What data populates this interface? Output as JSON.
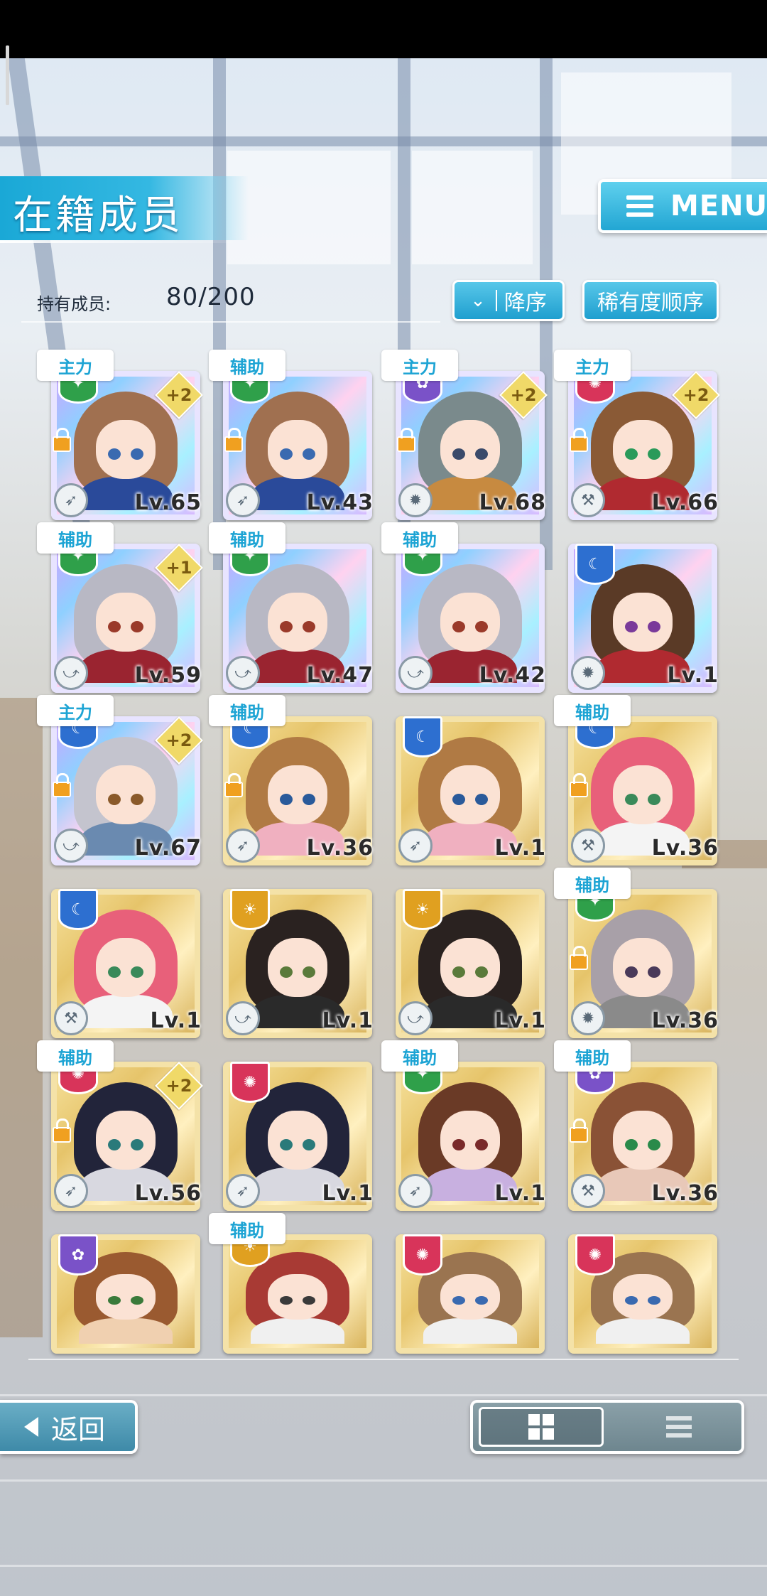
{
  "header": {
    "title": "在籍成员",
    "menu_label": "MENU",
    "menu_icon": "hamburger-icon"
  },
  "summary": {
    "count_label": "持有成员:",
    "count_value": "80/200"
  },
  "sort": {
    "order_label": "降序",
    "order_icon": "double-chevron-down-icon",
    "rarity_label": "稀有度顺序"
  },
  "colors": {
    "accent": "#22a6d3",
    "badge_text": "#1da4d4",
    "plus_gold": "#f0d968",
    "attr_green": "#2fa04a",
    "attr_purple": "#7a52c8",
    "attr_red": "#d8345a",
    "attr_blue": "#2d6fd0",
    "attr_orange": "#e0a020"
  },
  "cards": [
    {
      "role": "主力",
      "plus": "+2",
      "level": "Lv.65",
      "rarity": "sr",
      "attr": "green",
      "locked": true,
      "skill": "wind-icon",
      "hair": "#a07050",
      "eye": "#3a6ab0",
      "outfit": "#2a4a9a"
    },
    {
      "role": "辅助",
      "plus": "",
      "level": "Lv.43",
      "rarity": "sr",
      "attr": "green",
      "locked": true,
      "skill": "wind-icon",
      "hair": "#a07050",
      "eye": "#3a6ab0",
      "outfit": "#2a4a9a"
    },
    {
      "role": "主力",
      "plus": "+2",
      "level": "Lv.68",
      "rarity": "sr",
      "attr": "purple",
      "locked": true,
      "skill": "gear-icon",
      "hair": "#7a8a8c",
      "eye": "#3a4a6a",
      "outfit": "#c78a40"
    },
    {
      "role": "主力",
      "plus": "+2",
      "level": "Lv.66",
      "rarity": "sr",
      "attr": "red",
      "locked": true,
      "skill": "hammer-icon",
      "hair": "#8a5a36",
      "eye": "#2a9a5a",
      "outfit": "#b02a30"
    },
    {
      "role": "辅助",
      "plus": "+1",
      "level": "Lv.59",
      "rarity": "sr",
      "attr": "green",
      "locked": false,
      "skill": "boot-icon",
      "hair": "#b8b8c4",
      "eye": "#9a3a2a",
      "outfit": "#9a2430"
    },
    {
      "role": "辅助",
      "plus": "",
      "level": "Lv.47",
      "rarity": "sr",
      "attr": "green",
      "locked": false,
      "skill": "boot-icon",
      "hair": "#b8b8c4",
      "eye": "#9a3a2a",
      "outfit": "#9a2430"
    },
    {
      "role": "辅助",
      "plus": "",
      "level": "Lv.42",
      "rarity": "sr",
      "attr": "green",
      "locked": false,
      "skill": "boot-icon",
      "hair": "#b8b8c4",
      "eye": "#9a3a2a",
      "outfit": "#9a2430"
    },
    {
      "role": "",
      "plus": "",
      "level": "Lv.1",
      "rarity": "sr",
      "attr": "blue",
      "locked": false,
      "skill": "gear-icon",
      "hair": "#5a3a26",
      "eye": "#7a3a9a",
      "outfit": "#b02a30"
    },
    {
      "role": "主力",
      "plus": "+2",
      "level": "Lv.67",
      "rarity": "sr",
      "attr": "blue",
      "locked": true,
      "skill": "boot-icon",
      "hair": "#c4c4ce",
      "eye": "#8a5a2a",
      "outfit": "#6a8ab0"
    },
    {
      "role": "辅助",
      "plus": "",
      "level": "Lv.36",
      "rarity": "r",
      "attr": "blue",
      "locked": true,
      "skill": "wind-icon",
      "hair": "#b07a44",
      "eye": "#2a5a9a",
      "outfit": "#f0b0c0"
    },
    {
      "role": "",
      "plus": "",
      "level": "Lv.1",
      "rarity": "r",
      "attr": "blue",
      "locked": false,
      "skill": "wind-icon",
      "hair": "#b07a44",
      "eye": "#2a5a9a",
      "outfit": "#f0b0c0"
    },
    {
      "role": "辅助",
      "plus": "",
      "level": "Lv.36",
      "rarity": "r",
      "attr": "blue",
      "locked": true,
      "skill": "hammer-icon",
      "hair": "#e8607a",
      "eye": "#3a8a5a",
      "outfit": "#f4f4f4"
    },
    {
      "role": "",
      "plus": "",
      "level": "Lv.1",
      "rarity": "r",
      "attr": "blue",
      "locked": false,
      "skill": "hammer-icon",
      "hair": "#e8607a",
      "eye": "#3a8a5a",
      "outfit": "#f4f4f4"
    },
    {
      "role": "",
      "plus": "",
      "level": "Lv.1",
      "rarity": "r",
      "attr": "orange",
      "locked": false,
      "skill": "boot-icon",
      "hair": "#2a2220",
      "eye": "#5a7a3a",
      "outfit": "#2a2a2a"
    },
    {
      "role": "",
      "plus": "",
      "level": "Lv.1",
      "rarity": "r",
      "attr": "orange",
      "locked": false,
      "skill": "boot-icon",
      "hair": "#2a2220",
      "eye": "#5a7a3a",
      "outfit": "#2a2a2a"
    },
    {
      "role": "辅助",
      "plus": "",
      "level": "Lv.36",
      "rarity": "r",
      "attr": "green",
      "locked": true,
      "skill": "gear-icon",
      "hair": "#a8a0a8",
      "eye": "#4a3a5a",
      "outfit": "#8a8a8a"
    },
    {
      "role": "辅助",
      "plus": "+2",
      "level": "Lv.56",
      "rarity": "r",
      "attr": "red",
      "locked": true,
      "skill": "wind-icon",
      "hair": "#22243a",
      "eye": "#2a7a7a",
      "outfit": "#d8d8e0"
    },
    {
      "role": "",
      "plus": "",
      "level": "Lv.1",
      "rarity": "r",
      "attr": "red",
      "locked": false,
      "skill": "wind-icon",
      "hair": "#22243a",
      "eye": "#2a7a7a",
      "outfit": "#d8d8e0"
    },
    {
      "role": "辅助",
      "plus": "",
      "level": "Lv.1",
      "rarity": "r",
      "attr": "green",
      "locked": false,
      "skill": "wind-icon",
      "hair": "#6a3a26",
      "eye": "#7a2a2a",
      "outfit": "#c8b0e0"
    },
    {
      "role": "辅助",
      "plus": "",
      "level": "Lv.36",
      "rarity": "r",
      "attr": "purple",
      "locked": true,
      "skill": "hammer-icon",
      "hair": "#8a5236",
      "eye": "#2a8a4a",
      "outfit": "#e8c8b8"
    },
    {
      "role": "",
      "plus": "",
      "level": "",
      "rarity": "r",
      "attr": "purple",
      "locked": false,
      "skill": "",
      "hair": "#9a5a30",
      "eye": "#3a7a3a",
      "outfit": "#f0d0b0"
    },
    {
      "role": "辅助",
      "plus": "",
      "level": "",
      "rarity": "r",
      "attr": "orange",
      "locked": false,
      "skill": "",
      "hair": "#a83a34",
      "eye": "#3a3a3a",
      "outfit": "#f0f0f0"
    },
    {
      "role": "",
      "plus": "",
      "level": "",
      "rarity": "r",
      "attr": "red",
      "locked": false,
      "skill": "",
      "hair": "#9a7450",
      "eye": "#3a6ab0",
      "outfit": "#f0f0f0"
    },
    {
      "role": "",
      "plus": "",
      "level": "",
      "rarity": "r",
      "attr": "red",
      "locked": false,
      "skill": "",
      "hair": "#9a7450",
      "eye": "#3a6ab0",
      "outfit": "#f0f0f0"
    }
  ],
  "footer": {
    "back_label": "返回",
    "back_icon": "left-triangle-icon",
    "view_grid_icon": "grid-view-icon",
    "view_list_icon": "list-view-icon"
  }
}
